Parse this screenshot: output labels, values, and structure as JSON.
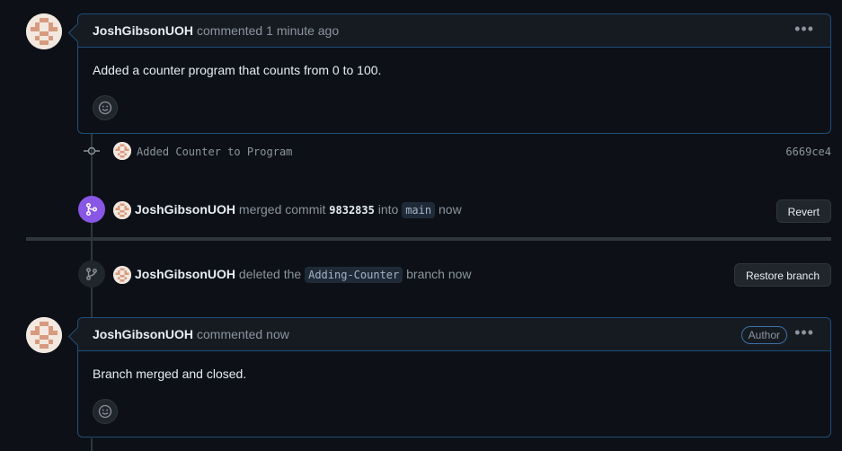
{
  "comment1": {
    "author": "JoshGibsonUOH",
    "action": "commented",
    "time": "1 minute ago",
    "body": "Added a counter program that counts from 0 to 100."
  },
  "commit_event": {
    "message": "Added Counter to Program",
    "sha": "6669ce4"
  },
  "merge_event": {
    "author": "JoshGibsonUOH",
    "action": "merged commit",
    "commit": "9832835",
    "into": "into",
    "branch": "main",
    "time": "now",
    "button": "Revert"
  },
  "delete_event": {
    "author": "JoshGibsonUOH",
    "action": "deleted the",
    "branch": "Adding-Counter",
    "suffix": "branch",
    "time": "now",
    "button": "Restore branch"
  },
  "comment2": {
    "author": "JoshGibsonUOH",
    "action": "commented",
    "time": "now",
    "badge": "Author",
    "body": "Branch merged and closed."
  },
  "colors": {
    "merged": "#8957e5",
    "border": "#1f4e7a",
    "background": "#0d1117"
  },
  "icons": [
    "smiley-icon",
    "kebab-icon",
    "commit-icon",
    "merge-icon",
    "branch-icon"
  ]
}
